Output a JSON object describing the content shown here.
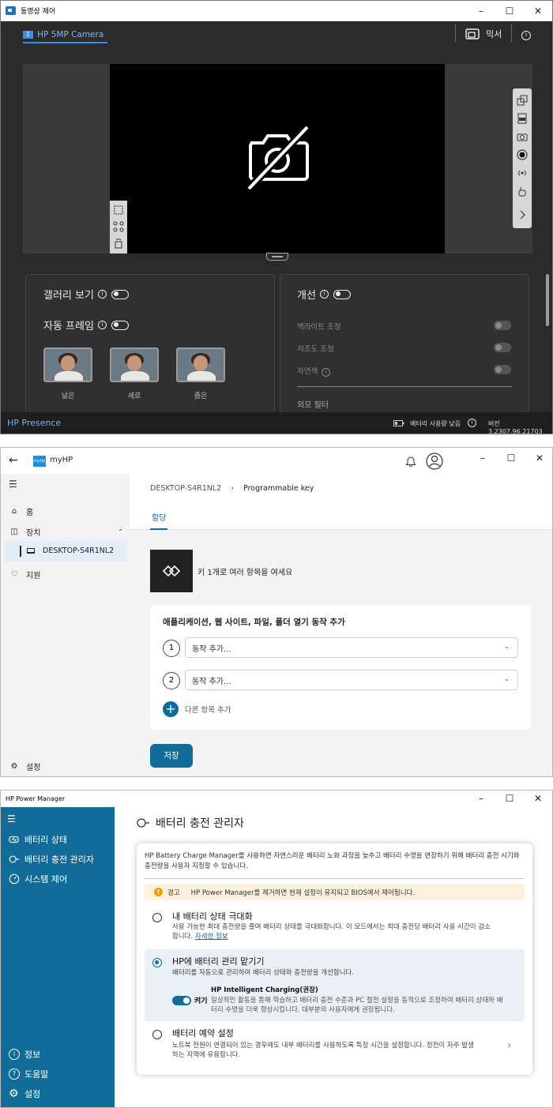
{
  "w1": {
    "title": "동영상 제어",
    "camera_tab": "HP 5MP Camera",
    "camera_tab_number": "1",
    "mixer_label": "믹서",
    "gallery_label": "갤러리 보기",
    "autoframe_label": "자동 프레임",
    "thumbs": [
      {
        "label": "넓은"
      },
      {
        "label": "세로"
      },
      {
        "label": "좁은"
      }
    ],
    "enhance_label": "개선",
    "backlight_label": "백라이트 조정",
    "lowlight_label": "저조도 조정",
    "natural_label": "자연색",
    "appearance_label": "외모 필터",
    "brand": "HP Presence",
    "battery_status": "배터리 사용량 낮음",
    "version": "버전 3.2307.96.21703"
  },
  "w2": {
    "app_name": "myHP",
    "logo_text": "myhp",
    "nav": {
      "home": "홈",
      "devices": "장치",
      "device_name": "DESKTOP-S4R1NL2",
      "support": "지원",
      "settings": "설정"
    },
    "breadcrumb_device": "DESKTOP-S4R1NL2",
    "breadcrumb_page": "Programmable key",
    "tab_assign": "할당",
    "key_desc": "키 1개로 여러 항목을 여세요",
    "card_title": "애플리케이션, 웹 사이트, 파일, 폴더 열기 동작 추가",
    "actions": [
      {
        "num": "1",
        "placeholder": "동작 추가..."
      },
      {
        "num": "2",
        "placeholder": "동작 추가..."
      }
    ],
    "add_more": "다른 항목 추가",
    "save": "저장"
  },
  "w3": {
    "title": "HP Power Manager",
    "nav": {
      "battery_status": "배터리 상태",
      "charge_manager": "배터리 충전 관리자",
      "system_control": "시스템 제어",
      "info": "정보",
      "help": "도움말",
      "settings": "설정"
    },
    "page_title": "배터리 충전 관리자",
    "intro_line1": "HP Battery Charge Manager를 사용하면 자연스러운 배터리 노화 과정을 늦추고 배터리 수명을 연장하기 위해 배터리 충전 시기와",
    "intro_line2": "충전량을 사용자 지정할 수 있습니다.",
    "warning_label": "경고",
    "warning_text": "HP Power Manager를 제거하면 현재 설정이 유지되고 BIOS에서 제어됩니다.",
    "opt1_title": "내 배터리 상태 극대화",
    "opt1_desc1": "사용 가능한 최대 충전량을 줄여 배터리 상태를 극대화합니다. 이 모드에서는 최대 충전당 배터리 사용 시간이 감소",
    "opt1_desc2": "합니다.",
    "opt1_link": "자세한 정보",
    "opt2_title": "HP에 배터리 관리 맡기기",
    "opt2_desc": "배터리를 자동으로 관리하여 배터리 상태와 충전량을 개선합니다.",
    "toggle_on": "켜기",
    "ic_title": "HP Intelligent Charging(권장)",
    "ic_desc1": "일상적인 활동을 통해 학습하고 배터리 충전 수준과 PC 절전 설정을 동적으로 조정하여 배터리 상태와 배",
    "ic_desc2": "터리 수명을 더욱 향상시킵니다. 대부분의 사용자에게 권장됩니다.",
    "opt3_title": "배터리 예약 설정",
    "opt3_desc1": "노트북 전원이 연결되어 있는 경우에도 내부 배터리를 사용하도록 특정 시간을 설정합니다. 정전이 자주 발생",
    "opt3_desc2": "하는 지역에 유용합니다."
  }
}
